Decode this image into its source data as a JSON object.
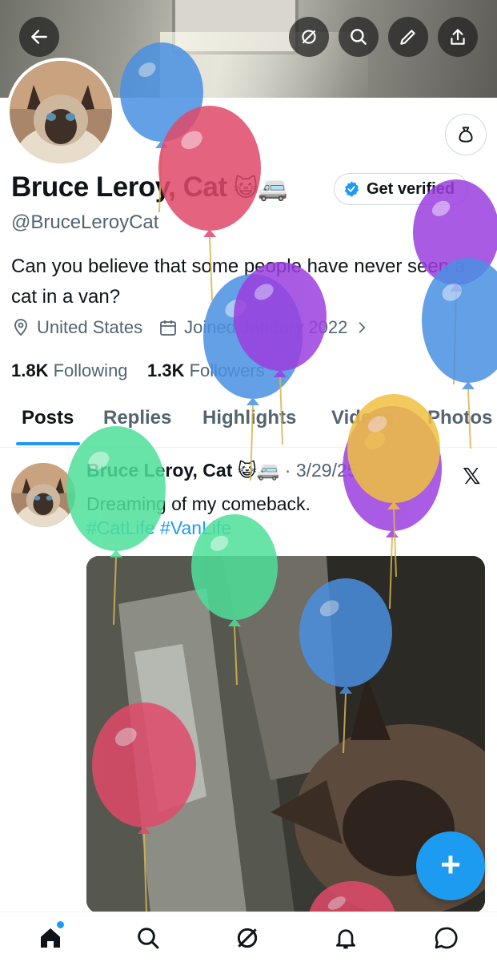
{
  "header": {
    "back_icon": "arrow-left-icon",
    "actions": [
      "grok-icon",
      "search-icon",
      "edit-icon",
      "share-icon"
    ]
  },
  "profile": {
    "name": "Bruce Leroy, Cat",
    "name_emoji": "😺🚐",
    "handle": "@BruceLeroyCat",
    "bio": "Can you believe that some people have never seen a cat in a van?",
    "location": "United States",
    "joined": "Joined January 2022",
    "following_count": "1.8K",
    "following_label": "Following",
    "followers_count": "1.3K",
    "followers_label": "Followers",
    "get_verified_label": "Get verified"
  },
  "tabs": [
    "Posts",
    "Replies",
    "Highlights",
    "Videos",
    "Photos"
  ],
  "active_tab": "Posts",
  "post": {
    "author": "Bruce Leroy, Cat",
    "author_emoji": "😺🚐",
    "date": "· 3/29/25",
    "text": "Dreaming of my comeback.",
    "hashtags": "#CatLife #VanLife"
  },
  "fab_label": "+",
  "nav": [
    "home-icon",
    "search-icon",
    "grok-icon",
    "notifications-icon",
    "messages-icon"
  ],
  "colors": {
    "accent": "#1d9bf0",
    "text": "#0f1419",
    "muted": "#536471",
    "balloon_blue": "#4a90e2",
    "balloon_red": "#e04a6a",
    "balloon_purple": "#9b3fe0",
    "balloon_green": "#4ee09a",
    "balloon_yellow": "#f0c040"
  }
}
